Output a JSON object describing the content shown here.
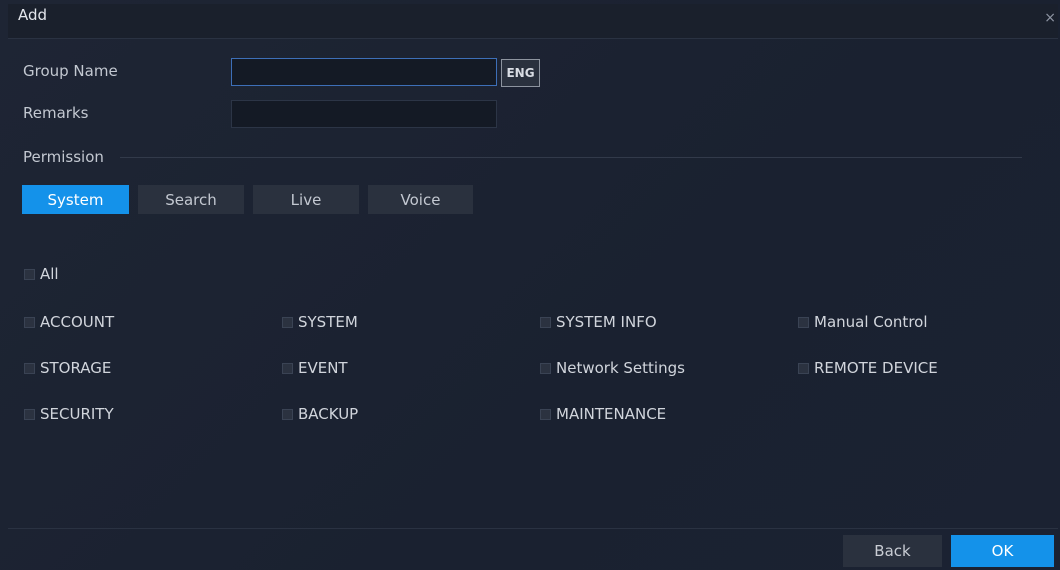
{
  "dialog": {
    "title": "Add",
    "close": "×"
  },
  "form": {
    "group_name_label": "Group Name",
    "group_name_value": "",
    "input_mode_badge": "ENG",
    "remarks_label": "Remarks",
    "remarks_value": ""
  },
  "permission": {
    "section_label": "Permission",
    "tabs": [
      {
        "label": "System",
        "active": true
      },
      {
        "label": "Search",
        "active": false
      },
      {
        "label": "Live",
        "active": false
      },
      {
        "label": "Voice",
        "active": false
      }
    ],
    "all_label": "All",
    "items": [
      {
        "label": "ACCOUNT",
        "checked": false
      },
      {
        "label": "SYSTEM",
        "checked": false
      },
      {
        "label": "SYSTEM INFO",
        "checked": false
      },
      {
        "label": "Manual Control",
        "checked": false
      },
      {
        "label": "STORAGE",
        "checked": false
      },
      {
        "label": "EVENT",
        "checked": false
      },
      {
        "label": "Network Settings",
        "checked": false
      },
      {
        "label": "REMOTE DEVICE",
        "checked": false
      },
      {
        "label": "SECURITY",
        "checked": false
      },
      {
        "label": "BACKUP",
        "checked": false
      },
      {
        "label": "MAINTENANCE",
        "checked": false
      }
    ]
  },
  "footer": {
    "back_label": "Back",
    "ok_label": "OK"
  },
  "colors": {
    "accent": "#1492ea",
    "background": "#1b2230",
    "tab_inactive": "#2a313e"
  }
}
